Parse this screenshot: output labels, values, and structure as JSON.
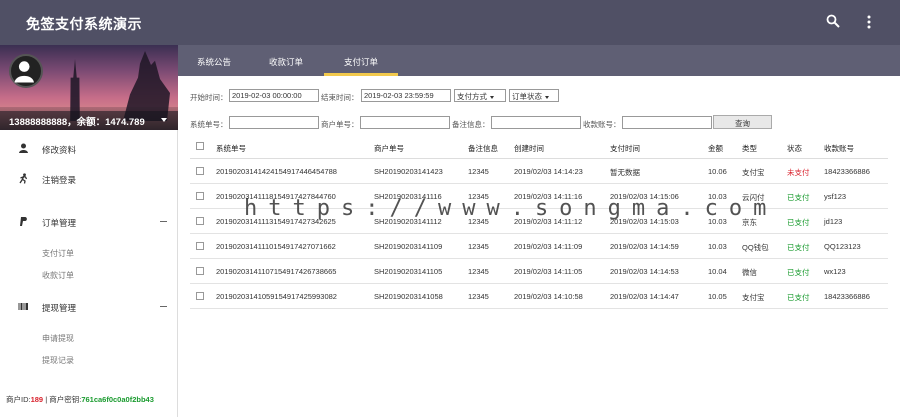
{
  "app": {
    "title": "免签支付系统演示"
  },
  "user": {
    "info": "13888888888，余额：1474.789"
  },
  "menu": {
    "profile": "修改资料",
    "logout": "注销登录",
    "orders": "订单管理",
    "orders_sub": [
      "支付订单",
      "收款订单"
    ],
    "withdraw": "提现管理",
    "withdraw_sub": [
      "申请提现",
      "提现记录"
    ]
  },
  "footer": {
    "merchant_id_label": "商户ID:",
    "merchant_id": "189",
    "sep": " | 商户密钥:",
    "merchant_key": "761ca6f0c0a0f2bb43"
  },
  "tabs": [
    "系统公告",
    "收款订单",
    "支付订单"
  ],
  "filters": {
    "start_label": "开始时间：",
    "start_value": "2019-02-03 00:00:00",
    "end_label": "结束时间：",
    "end_value": "2019-02-03 23:59:59",
    "pay_method": "支付方式",
    "order_status": "订单状态",
    "sys_no_label": "系统单号：",
    "merchant_no_label": "商户单号：",
    "remark_label": "备注信息：",
    "account_label": "收款账号：",
    "query": "查询"
  },
  "table": {
    "headers": [
      "系统单号",
      "商户单号",
      "备注信息",
      "创建时间",
      "支付时间",
      "金额",
      "类型",
      "状态",
      "收款账号"
    ],
    "rows": [
      [
        "20190203141424154917446454788",
        "SH20190203141423",
        "12345",
        "2019/02/03 14:14:23",
        "暂无数据",
        "10.06",
        "支付宝",
        "未支付",
        "18423366886"
      ],
      [
        "20190203141118154917427844760",
        "SH20190203141116",
        "12345",
        "2019/02/03 14:11:16",
        "2019/02/03 14:15:06",
        "10.03",
        "云闪付",
        "已支付",
        "ysf123"
      ],
      [
        "20190203141113154917427342625",
        "SH20190203141112",
        "12345",
        "2019/02/03 14:11:12",
        "2019/02/03 14:15:03",
        "10.03",
        "京东",
        "已支付",
        "jd123"
      ],
      [
        "20190203141110154917427071662",
        "SH20190203141109",
        "12345",
        "2019/02/03 14:11:09",
        "2019/02/03 14:14:59",
        "10.03",
        "QQ钱包",
        "已支付",
        "QQ123123"
      ],
      [
        "20190203141107154917426738665",
        "SH20190203141105",
        "12345",
        "2019/02/03 14:11:05",
        "2019/02/03 14:14:53",
        "10.04",
        "微信",
        "已支付",
        "wx123"
      ],
      [
        "20190203141059154917425993082",
        "SH20190203141058",
        "12345",
        "2019/02/03 14:10:58",
        "2019/02/03 14:14:47",
        "10.05",
        "支付宝",
        "已支付",
        "18423366886"
      ]
    ]
  },
  "watermark": "https://www.songma.com"
}
